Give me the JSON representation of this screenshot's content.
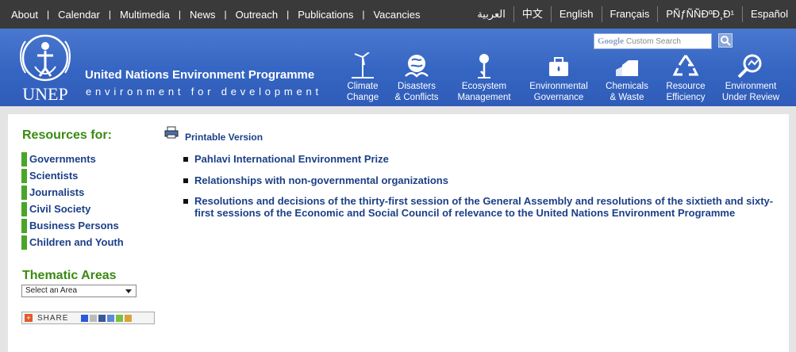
{
  "top_nav": {
    "left": [
      "About",
      "Calendar",
      "Multimedia",
      "News",
      "Outreach",
      "Publications",
      "Vacancies"
    ],
    "languages": [
      "العربية",
      "中文",
      "English",
      "Français",
      "PÑƒÑÑÐºÐ¸Ð¹",
      "Español"
    ]
  },
  "banner": {
    "org_title": "United Nations Environment Programme",
    "tagline": "environment for development",
    "logo_text": "UNEP",
    "search_brand": "Google",
    "search_placeholder": "Custom Search",
    "categories": [
      {
        "line1": "Climate",
        "line2": "Change"
      },
      {
        "line1": "Disasters",
        "line2": "& Conflicts"
      },
      {
        "line1": "Ecosystem",
        "line2": "Management"
      },
      {
        "line1": "Environmental",
        "line2": "Governance"
      },
      {
        "line1": "Chemicals",
        "line2": "& Waste"
      },
      {
        "line1": "Resource",
        "line2": "Efficiency"
      },
      {
        "line1": "Environment",
        "line2": "Under Review"
      }
    ]
  },
  "sidebar": {
    "resources_title": "Resources for:",
    "resources": [
      "Governments",
      "Scientists",
      "Journalists",
      "Civil Society",
      "Business Persons",
      "Children and Youth"
    ],
    "thematic_title": "Thematic Areas",
    "thematic_select": "Select an Area",
    "share_label": "SHARE"
  },
  "main": {
    "printable": "Printable Version",
    "links": [
      "Pahlavi International Environment Prize",
      "Relationships with non-governmental organizations",
      "Resolutions and decisions of the thirty-first session of the General Assembly and resolutions of the sixtieth and sixty-first sessions of the Economic and Social Council of relevance to the United Nations Environment Programme"
    ]
  },
  "colors": {
    "top_bar": "#3a3a3a",
    "banner": "#3565c2",
    "green_heading": "#3a8a12",
    "link_blue": "#1b3f87"
  }
}
